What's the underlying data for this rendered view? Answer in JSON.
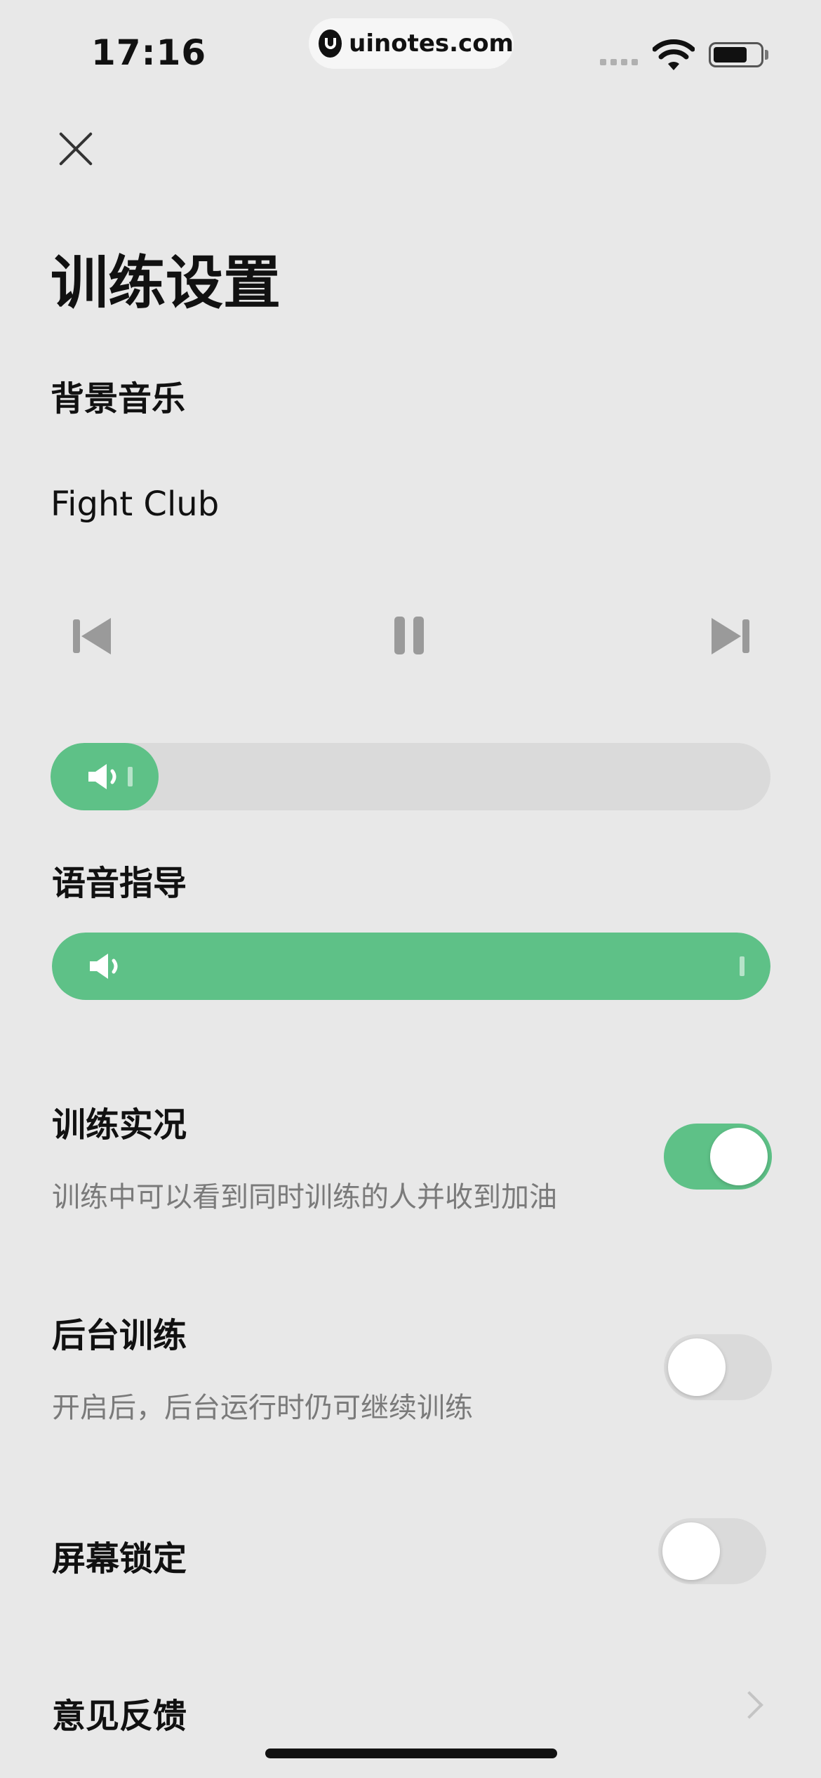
{
  "status_bar": {
    "time": "17:16",
    "url": "uinotes.com"
  },
  "header": {
    "close_icon": "close-icon",
    "title": "训练设置"
  },
  "background_music": {
    "label": "背景音乐",
    "track": "Fight Club",
    "controls": [
      "previous-icon",
      "pause-icon",
      "next-icon"
    ],
    "volume_level": 0.15
  },
  "voice_guide": {
    "label": "语音指导",
    "volume_level": 1.0
  },
  "settings": [
    {
      "title": "训练实况",
      "description": "训练中可以看到同时训练的人并收到加油",
      "enabled": true
    },
    {
      "title": "后台训练",
      "description": "开启后，后台运行时仍可继续训练",
      "enabled": false
    },
    {
      "title": "屏幕锁定",
      "enabled": false
    }
  ],
  "feedback": {
    "label": "意见反馈",
    "icon": "chevron-right-icon"
  },
  "colors": {
    "accent": "#5ec187",
    "background": "#e8e8e8",
    "track_off": "#dadada"
  }
}
